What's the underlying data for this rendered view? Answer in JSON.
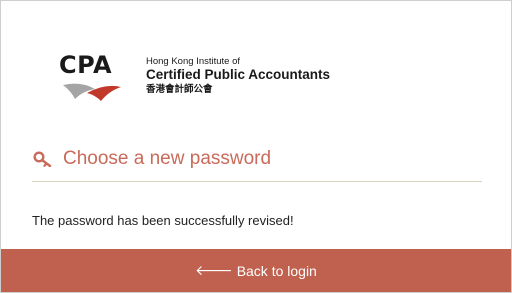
{
  "brand": {
    "abbr": "CPA",
    "line1": "Hong Kong Institute of",
    "line2": "Certified Public Accountants",
    "line3": "香港會計師公會"
  },
  "form": {
    "icon": "key-icon",
    "title": "Choose a new password",
    "message": "The password has been successfully revised!"
  },
  "actions": {
    "back_icon": "arrow-left-icon",
    "back_label": "Back to login"
  },
  "colors": {
    "accent": "#c96a5a",
    "button": "#c0604e",
    "logo_red": "#c0392b",
    "logo_grey": "#9a9a9a"
  }
}
